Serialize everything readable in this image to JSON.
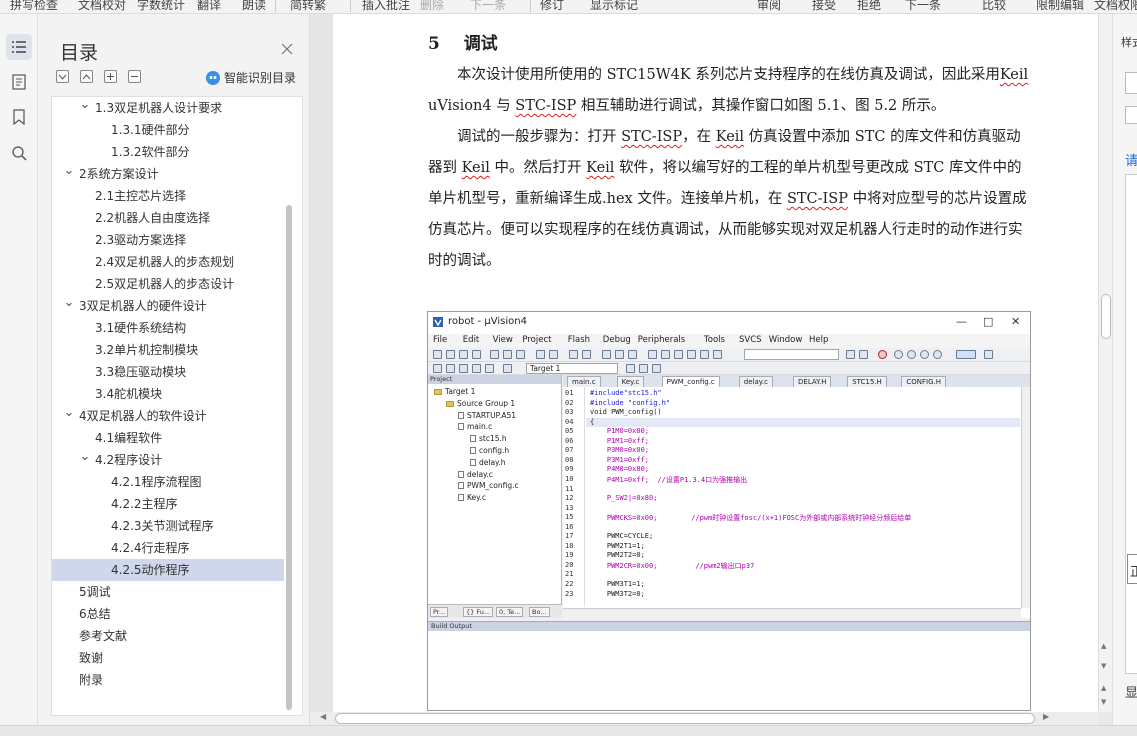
{
  "toolbar": {
    "items": [
      "拼写检查",
      "文档校对",
      "字数统计",
      "翻译",
      "朗读",
      "简转繁",
      "插入批注",
      "删除",
      "下一条",
      "修订",
      "显示标记",
      "审阅",
      "接受",
      "拒绝",
      "下一条",
      "比较",
      "限制编辑",
      "文档权限"
    ]
  },
  "toc": {
    "title": "目录",
    "smart_label": "智能识别目录",
    "items": [
      {
        "label": "1.3双足机器人设计要求",
        "level": 2,
        "expanded": true,
        "selected": false
      },
      {
        "label": "1.3.1硬件部分",
        "level": 3,
        "selected": false
      },
      {
        "label": "1.3.2软件部分",
        "level": 3,
        "selected": false
      },
      {
        "label": "2系统方案设计",
        "level": 1,
        "expanded": true,
        "selected": false
      },
      {
        "label": "2.1主控芯片选择",
        "level": 2,
        "selected": false
      },
      {
        "label": "2.2机器人自由度选择",
        "level": 2,
        "selected": false
      },
      {
        "label": "2.3驱动方案选择",
        "level": 2,
        "selected": false
      },
      {
        "label": "2.4双足机器人的步态规划",
        "level": 2,
        "selected": false
      },
      {
        "label": "2.5双足机器人的步态设计",
        "level": 2,
        "selected": false
      },
      {
        "label": "3双足机器人的硬件设计",
        "level": 1,
        "expanded": true,
        "selected": false
      },
      {
        "label": "3.1硬件系统结构",
        "level": 2,
        "selected": false
      },
      {
        "label": "3.2单片机控制模块",
        "level": 2,
        "selected": false
      },
      {
        "label": "3.3稳压驱动模块",
        "level": 2,
        "selected": false
      },
      {
        "label": "3.4舵机模块",
        "level": 2,
        "selected": false
      },
      {
        "label": "4双足机器人的软件设计",
        "level": 1,
        "expanded": true,
        "selected": false
      },
      {
        "label": "4.1编程软件",
        "level": 2,
        "selected": false
      },
      {
        "label": "4.2程序设计",
        "level": 2,
        "expanded": true,
        "selected": false
      },
      {
        "label": "4.2.1程序流程图",
        "level": 3,
        "selected": false
      },
      {
        "label": "4.2.2主程序",
        "level": 3,
        "selected": false
      },
      {
        "label": "4.2.3关节测试程序",
        "level": 3,
        "selected": false
      },
      {
        "label": "4.2.4行走程序",
        "level": 3,
        "selected": false
      },
      {
        "label": "4.2.5动作程序",
        "level": 3,
        "selected": true
      },
      {
        "label": "5调试",
        "level": 0,
        "selected": false
      },
      {
        "label": "6总结",
        "level": 0,
        "selected": false
      },
      {
        "label": "参考文献",
        "level": 0,
        "selected": false
      },
      {
        "label": "致谢",
        "level": 0,
        "selected": false
      },
      {
        "label": "附录",
        "level": 0,
        "selected": false
      }
    ]
  },
  "doc": {
    "heading_num": "5",
    "heading_text": "调试",
    "p1_a": "本次设计使用所使用的 STC15W4K 系列芯片支持程序的在线仿真及调试，因此采用",
    "p1_keil": "Keil",
    "p1_b": " uVision4 与 ",
    "p1_isp": "STC-ISP",
    "p1_c": " 相互辅助进行调试，其操作窗口如图 5.1、图 5.2 所示。",
    "p2_a": "调试的一般步骤为：打开 ",
    "p2_isp1": "STC-ISP",
    "p2_b": "，在 ",
    "p2_keil1": "Keil",
    "p2_c": " 仿真设置中添加 STC 的库文件和仿真驱动器到 ",
    "p2_keil2": "Keil",
    "p2_d": " 中。然后打开 ",
    "p2_keil3": "Keil",
    "p2_e": " 软件，将以编写好的工程的单片机型号更改成 STC 库文件中的单片机型号，重新编译生成.hex 文件。连接单片机，在 ",
    "p2_isp2": "STC-ISP",
    "p2_f": " 中将对应型号的芯片设置成仿真芯片。便可以实现程序的在线仿真调试，从而能够实现对双足机器人行走时的动作进行实时的调试。"
  },
  "keil": {
    "title": "robot - µVision4",
    "menus": [
      "File",
      "Edit",
      "View",
      "Project",
      "Flash",
      "Debug",
      "Peripherals",
      "Tools",
      "SVCS",
      "Window",
      "Help"
    ],
    "target_combo": "Target 1",
    "project_panel_title": "Project",
    "tree": [
      {
        "label": "Target 1",
        "indent": 0,
        "type": "folder"
      },
      {
        "label": "Source Group 1",
        "indent": 1,
        "type": "folder"
      },
      {
        "label": "STARTUP.A51",
        "indent": 2,
        "type": "file"
      },
      {
        "label": "main.c",
        "indent": 2,
        "type": "file"
      },
      {
        "label": "stc15.h",
        "indent": 3,
        "type": "file"
      },
      {
        "label": "config.h",
        "indent": 3,
        "type": "file"
      },
      {
        "label": "delay.h",
        "indent": 3,
        "type": "file"
      },
      {
        "label": "delay.c",
        "indent": 2,
        "type": "file"
      },
      {
        "label": "PWM_config.c",
        "indent": 2,
        "type": "file"
      },
      {
        "label": "Key.c",
        "indent": 2,
        "type": "file"
      }
    ],
    "bottom_tabs": [
      "Pr...",
      "{} Fu...",
      "0, Te...",
      "Bo..."
    ],
    "editor_tabs": [
      "main.c",
      "Key.c",
      "PWM_config.c",
      "delay.c",
      "DELAY.H",
      "STC15.H",
      "CONFIG.H"
    ],
    "active_tab": "PWM_config.c",
    "lines": [
      {
        "n": "01",
        "t": "#include\"stc15.h\"",
        "c": "blue"
      },
      {
        "n": "02",
        "t": "#include \"config.h\"",
        "c": "blue"
      },
      {
        "n": "03",
        "t": "void PWM_config()",
        "c": ""
      },
      {
        "n": "04",
        "t": "{",
        "c": ""
      },
      {
        "n": "05",
        "t": "    P1M0=0x00;",
        "c": "pink"
      },
      {
        "n": "06",
        "t": "    P1M1=0xff;",
        "c": "pink"
      },
      {
        "n": "07",
        "t": "    P3M0=0x00;",
        "c": "pink"
      },
      {
        "n": "08",
        "t": "    P3M1=0xff;",
        "c": "pink"
      },
      {
        "n": "09",
        "t": "    P4M0=0x00;",
        "c": "pink"
      },
      {
        "n": "10",
        "t": "    P4M1=0xff;  //设置P1.3.4口为强推输出",
        "c": "pink"
      },
      {
        "n": "11",
        "t": "",
        "c": ""
      },
      {
        "n": "12",
        "t": "    P_SW2|=0x80;",
        "c": "pink"
      },
      {
        "n": "13",
        "t": "",
        "c": ""
      },
      {
        "n": "15",
        "t": "    PWMCKS=0x00;        //pwm时钟设置fosc/(x+1)FOSC为外部或内部系统时钟经分频后给单",
        "c": "pink"
      },
      {
        "n": "16",
        "t": "",
        "c": ""
      },
      {
        "n": "17",
        "t": "    PWMC=CYCLE;",
        "c": ""
      },
      {
        "n": "18",
        "t": "    PWM2T1=1;",
        "c": ""
      },
      {
        "n": "19",
        "t": "    PWM2T2=0;",
        "c": ""
      },
      {
        "n": "20",
        "t": "    PWM2CR=0x00;         //pwm2输出口p37",
        "c": "pink"
      },
      {
        "n": "21",
        "t": "",
        "c": ""
      },
      {
        "n": "22",
        "t": "    PWM3T1=1;",
        "c": ""
      },
      {
        "n": "23",
        "t": "    PWM3T2=0;",
        "c": ""
      }
    ],
    "build_title": "Build Output"
  },
  "right": {
    "t1": "样式",
    "t2": "请",
    "t3": "正",
    "t4": "显"
  }
}
